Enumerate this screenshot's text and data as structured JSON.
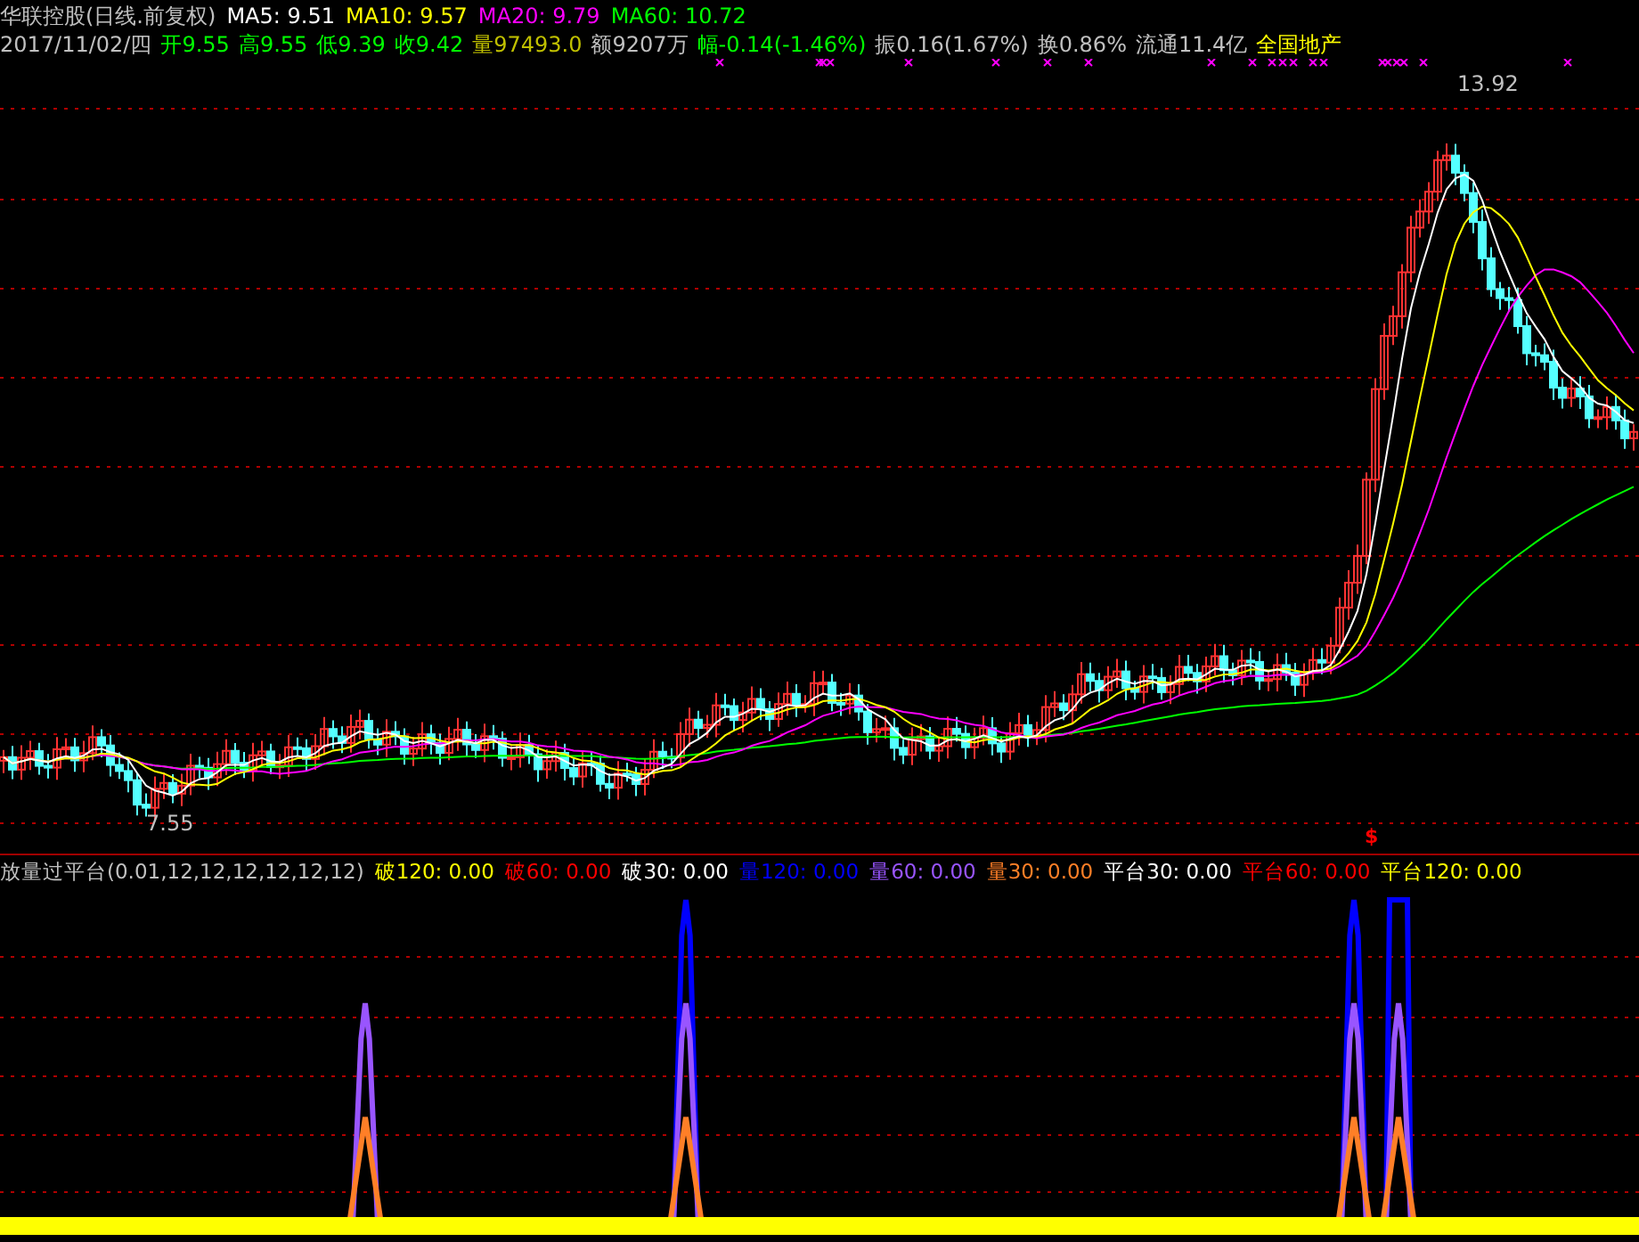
{
  "header": {
    "title": "华联控股(日线.前复权)",
    "moving_averages": [
      {
        "label": "MA5: 9.51",
        "color": "#ffffff"
      },
      {
        "label": "MA10: 9.57",
        "color": "#ffff00"
      },
      {
        "label": "MA20: 9.79",
        "color": "#ff00ff"
      },
      {
        "label": "MA60: 10.72",
        "color": "#00ff00"
      }
    ],
    "quote": [
      {
        "label": "2017/11/02/四",
        "color": "#c0c0c0"
      },
      {
        "label": "开9.55",
        "color": "#00ff00"
      },
      {
        "label": "高9.55",
        "color": "#00ff00"
      },
      {
        "label": "低9.39",
        "color": "#00ff00"
      },
      {
        "label": "收9.42",
        "color": "#00ff00"
      },
      {
        "label": "量97493.0",
        "color": "#c0c000"
      },
      {
        "label": "额9207万",
        "color": "#c0c0c0"
      },
      {
        "label": "幅-0.14(-1.46%)",
        "color": "#00ff00"
      },
      {
        "label": "振0.16(1.67%)",
        "color": "#c0c0c0"
      },
      {
        "label": "换0.86%",
        "color": "#c0c0c0"
      },
      {
        "label": "流通11.4亿",
        "color": "#c0c0c0"
      },
      {
        "label": "全国地产",
        "color": "#ffff00"
      }
    ]
  },
  "price_chart": {
    "high_label": "13.92",
    "low_label": "7.55",
    "signal_mark": "$"
  },
  "indicator": {
    "title": "放量过平台(0.01,12,12,12,12,12,12)",
    "values": [
      {
        "label": "破120: 0.00",
        "color": "#ffff00"
      },
      {
        "label": "破60: 0.00",
        "color": "#ff0000"
      },
      {
        "label": "破30: 0.00",
        "color": "#ffffff"
      },
      {
        "label": "量120: 0.00",
        "color": "#0000ff"
      },
      {
        "label": "量60: 0.00",
        "color": "#9955ff"
      },
      {
        "label": "量30: 0.00",
        "color": "#ff7f27"
      },
      {
        "label": "平台30: 0.00",
        "color": "#ffffff"
      },
      {
        "label": "平台60: 0.00",
        "color": "#ff0000"
      },
      {
        "label": "平台120: 0.00",
        "color": "#ffff00"
      }
    ]
  }
}
